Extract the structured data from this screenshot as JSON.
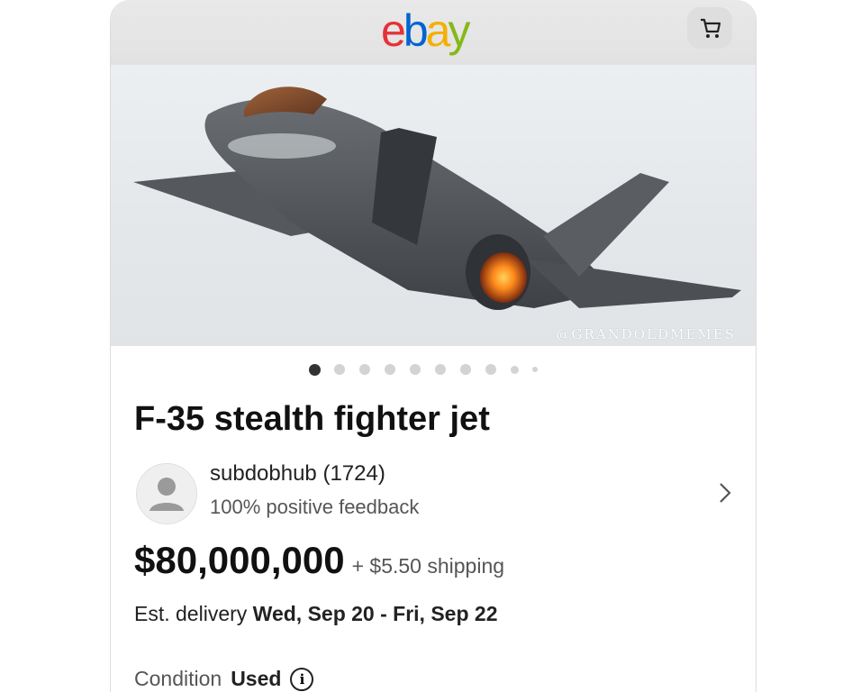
{
  "header": {
    "logo_letters": [
      "e",
      "b",
      "a",
      "y"
    ],
    "logo_colors": [
      "#e53238",
      "#0064d2",
      "#f5af02",
      "#86b817"
    ],
    "cart_icon": "cart-icon"
  },
  "listing": {
    "watermark": "@GRANDOLDMEMES",
    "image_count": 10,
    "active_image": 1,
    "title": "F-35 stealth fighter jet",
    "seller": {
      "name": "subdobhub (1724)",
      "feedback": "100% positive feedback"
    },
    "price": "$80,000,000",
    "shipping": "+ $5.50 shipping",
    "delivery": {
      "label": "Est. delivery ",
      "dates": "Wed, Sep 20 - Fri, Sep 22"
    },
    "condition": {
      "label": "Condition",
      "value": "Used",
      "info_glyph": "i"
    }
  }
}
